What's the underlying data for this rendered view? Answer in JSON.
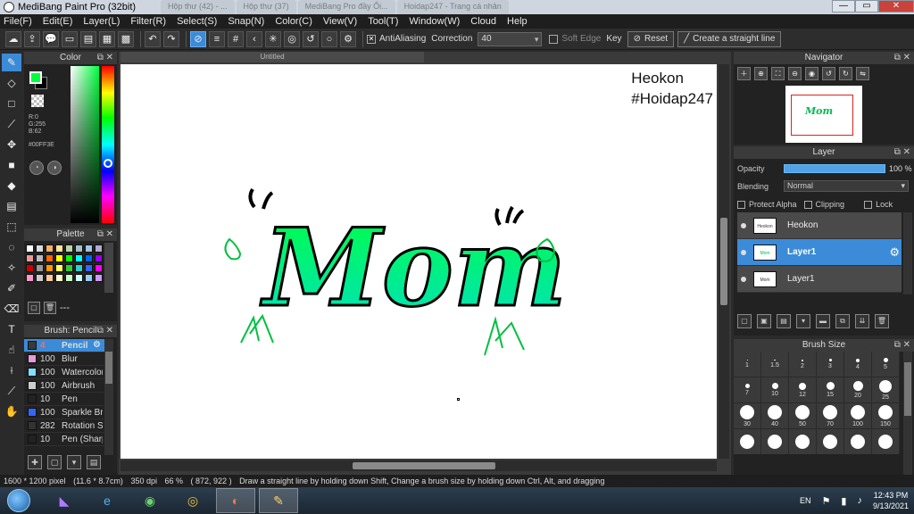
{
  "window": {
    "title": "MediBang Paint Pro (32bit)",
    "ghost_tabs": [
      "Hộp thư (42) - ...",
      "Hộp thư (37)",
      "MediBang Pro đầy Ổi...",
      "Hoidap247 - Trang cá nhân"
    ],
    "controls": [
      "—",
      "▭",
      "✕"
    ]
  },
  "menu": [
    "File(F)",
    "Edit(E)",
    "Layer(L)",
    "Filter(R)",
    "Select(S)",
    "Snap(N)",
    "Color(C)",
    "View(V)",
    "Tool(T)",
    "Window(W)",
    "Cloud",
    "Help"
  ],
  "toolbar": {
    "antialias_label": "AntiAliasing",
    "correction_label": "Correction",
    "correction_value": "40",
    "soft_edge_label": "Soft Edge",
    "key_label": "Key",
    "reset_label": "Reset",
    "straight_line_label": "Create a straight line"
  },
  "color_panel": {
    "title": "Color",
    "rgb": "R:0\nG:255\nB:62",
    "hex": "#00FF3E",
    "foreground": "#00FF3E",
    "background": "#000000"
  },
  "palette_panel": {
    "title": "Palette",
    "colors": [
      "#ffffff",
      "#dddddd",
      "#f6b26b",
      "#ffe599",
      "#b6d7a8",
      "#a2c4c9",
      "#9fc5e8",
      "#b4a7d6",
      "#ea9999",
      "#bbbbbb",
      "#ff6600",
      "#ffff00",
      "#00ff00",
      "#00ffff",
      "#0066ff",
      "#9900ff",
      "#cc0000",
      "#999999",
      "#ff9900",
      "#ffff66",
      "#33cc33",
      "#33cccc",
      "#3366ff",
      "#ff00ff",
      "#ff99cc",
      "#cccccc",
      "#ffcc99",
      "#ffffcc",
      "#ccffcc",
      "#ccffff",
      "#99ccff",
      "#cc99ff"
    ],
    "footer": "---"
  },
  "brush_panel": {
    "title": "Brush: Pencil",
    "items": [
      {
        "size": "4",
        "name": "Pencil",
        "color": "#3a3a3a"
      },
      {
        "size": "100",
        "name": "Blur",
        "color": "#e79ad8"
      },
      {
        "size": "100",
        "name": "Watercolor",
        "color": "#7fe0ff"
      },
      {
        "size": "100",
        "name": "Airbrush",
        "color": "#cccccc"
      },
      {
        "size": "10",
        "name": "Pen",
        "color": "#222222"
      },
      {
        "size": "100",
        "name": "Sparkle Brush",
        "color": "#3366ff"
      },
      {
        "size": "282",
        "name": "Rotation Symmetry",
        "color": "#333333"
      },
      {
        "size": "10",
        "name": "Pen (Sharp)",
        "color": "#222222"
      }
    ]
  },
  "canvas": {
    "doc_title": "Untitled",
    "watermark_line1": "Heokon",
    "watermark_line2": "#Hoidap247",
    "artwork_text": "Mom"
  },
  "navigator": {
    "title": "Navigator",
    "thumb_text": "Mom"
  },
  "layer_panel": {
    "title": "Layer",
    "opacity_label": "Opacity",
    "opacity_value": "100 %",
    "opacity_level": 1.0,
    "blending_label": "Blending",
    "blending_value": "Normal",
    "protect_alpha": "Protect Alpha",
    "clipping": "Clipping",
    "lock": "Lock",
    "layers": [
      {
        "name": "Heokon",
        "thumb": "Heokon #Hoidap247"
      },
      {
        "name": "Layer1",
        "thumb": "Mom"
      },
      {
        "name": "Layer1",
        "thumb": "Mom"
      }
    ]
  },
  "brush_size_panel": {
    "title": "Brush Size",
    "sizes": [
      "1",
      "1.5",
      "2",
      "3",
      "4",
      "5",
      "7",
      "10",
      "12",
      "15",
      "20",
      "25",
      "30",
      "40",
      "50",
      "70",
      "100",
      "150",
      "",
      "",
      "",
      "",
      "",
      ""
    ]
  },
  "status": {
    "pixels": "1600 * 1200 pixel",
    "cm": "(11.6 * 8.7cm)",
    "dpi": "350 dpi",
    "zoom": "66 %",
    "coords": "( 872, 922 )",
    "hint": "Draw a straight line by holding down Shift, Change a brush size by holding down Ctrl, Alt, and dragging"
  },
  "taskbar": {
    "lang": "EN",
    "time": "12:43 PM",
    "date": "9/13/2021"
  }
}
